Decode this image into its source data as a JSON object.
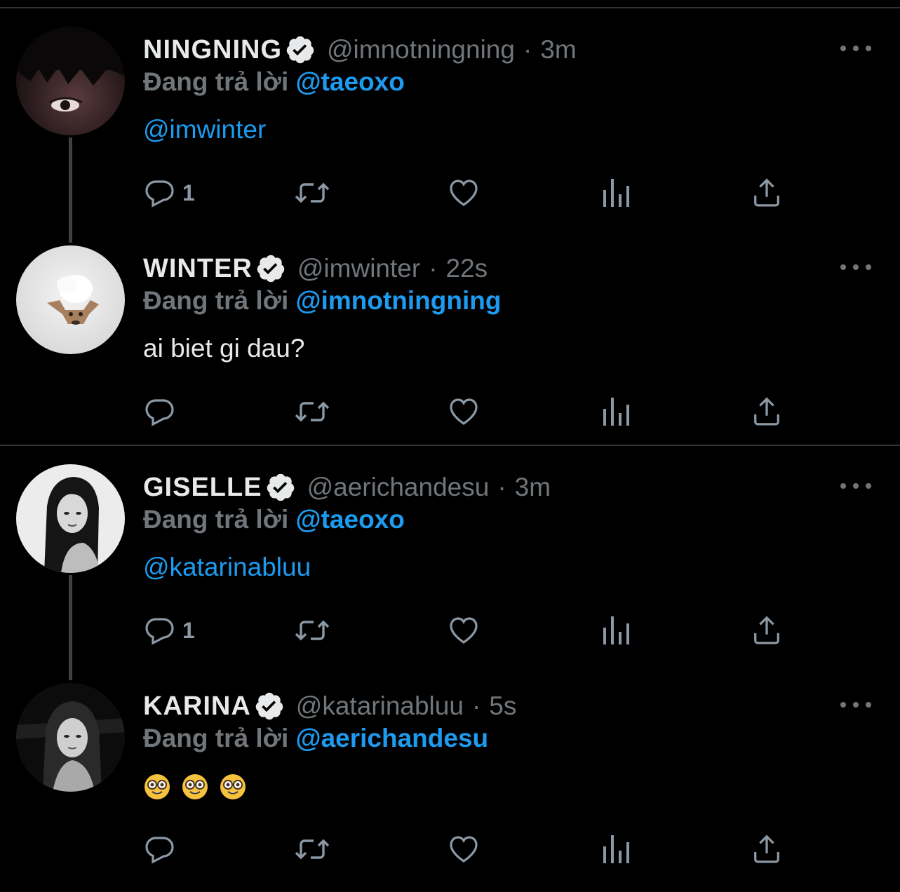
{
  "colors": {
    "background": "#000000",
    "name": "#e7e9ea",
    "secondary": "#71767b",
    "accent": "#1d9bf0",
    "icon": "#8b98a5",
    "divider": "#2f3336"
  },
  "tweets": [
    {
      "name": "NINGNING",
      "handle": "@imnotningning",
      "separator": "·",
      "time": "3m",
      "reply_prefix": "Đang trả lời",
      "reply_to": "@taeoxo",
      "body": "@imwinter",
      "body_is_mention": true,
      "reply_count": "1"
    },
    {
      "name": "WINTER",
      "handle": "@imwinter",
      "separator": "·",
      "time": "22s",
      "reply_prefix": "Đang trả lời",
      "reply_to": "@imnotningning",
      "body": "ai biet gi dau?",
      "body_is_mention": false,
      "reply_count": ""
    },
    {
      "name": "GISELLE",
      "handle": "@aerichandesu",
      "separator": "·",
      "time": "3m",
      "reply_prefix": "Đang trả lời",
      "reply_to": "@taeoxo",
      "body": "@katarinabluu",
      "body_is_mention": true,
      "reply_count": "1"
    },
    {
      "name": "KARINA",
      "handle": "@katarinabluu",
      "separator": "·",
      "time": "5s",
      "reply_prefix": "Đang trả lời",
      "reply_to": "@aerichandesu",
      "body_emojis": [
        "nerd-face-emoji",
        "nerd-face-emoji",
        "nerd-face-emoji"
      ],
      "reply_count": ""
    }
  ],
  "icons": {
    "reply": "reply-icon",
    "retweet": "retweet-icon",
    "like": "heart-icon",
    "views": "analytics-icon",
    "share": "share-icon",
    "more": "more-icon",
    "verified": "verified-badge-icon"
  }
}
